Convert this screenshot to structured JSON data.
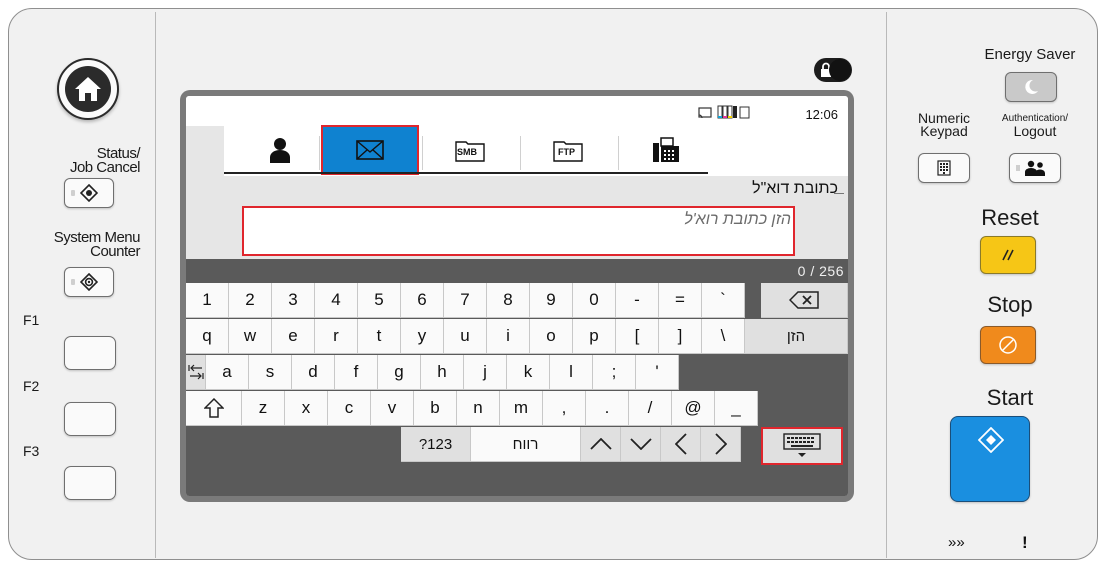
{
  "left_panel": {
    "status_label_line1": "Status/",
    "status_label_line2": "Job Cancel",
    "system_label_line1": "System Menu",
    "system_label_line2": "Counter",
    "f1": "F1",
    "f2": "F2",
    "f3": "F3"
  },
  "screen": {
    "time": "12:06",
    "tabs": [
      {
        "name": "address-book",
        "icon": "person-icon"
      },
      {
        "name": "email",
        "icon": "envelope-icon",
        "active": true
      },
      {
        "name": "smb",
        "label": "SMB"
      },
      {
        "name": "ftp",
        "label": "FTP"
      },
      {
        "name": "fax",
        "icon": "fax-icon"
      }
    ],
    "field_title": "כתובת דוא\"ל",
    "field_placeholder": "הזן כתובת רוא'ל",
    "counter": "0 / 256",
    "keyboard": {
      "row1": [
        "1",
        "2",
        "3",
        "4",
        "5",
        "6",
        "7",
        "8",
        "9",
        "0",
        "-",
        "=",
        "`"
      ],
      "row2": [
        "q",
        "w",
        "e",
        "r",
        "t",
        "y",
        "u",
        "i",
        "o",
        "p",
        "[",
        "]",
        "\\"
      ],
      "row2_enter": "הזן",
      "row3": [
        "a",
        "s",
        "d",
        "f",
        "g",
        "h",
        "j",
        "k",
        "l",
        ";",
        "'"
      ],
      "row4": [
        "z",
        "x",
        "c",
        "v",
        "b",
        "n",
        "m",
        ",",
        ".",
        "/",
        "@",
        "_"
      ],
      "mode_key": "?123",
      "space_key": "רווח"
    }
  },
  "right_panel": {
    "energy_saver": "Energy Saver",
    "numeric_keypad_line1": "Numeric",
    "numeric_keypad_line2": "Keypad",
    "auth_line1": "Authentication/",
    "auth_line2": "Logout",
    "reset": "Reset",
    "stop": "Stop",
    "start": "Start",
    "colors": {
      "reset": "#f6c616",
      "stop": "#f08a1c",
      "start": "#1a8fe0",
      "accent_tab": "#0f82d0",
      "highlight": "#e0262d"
    }
  }
}
